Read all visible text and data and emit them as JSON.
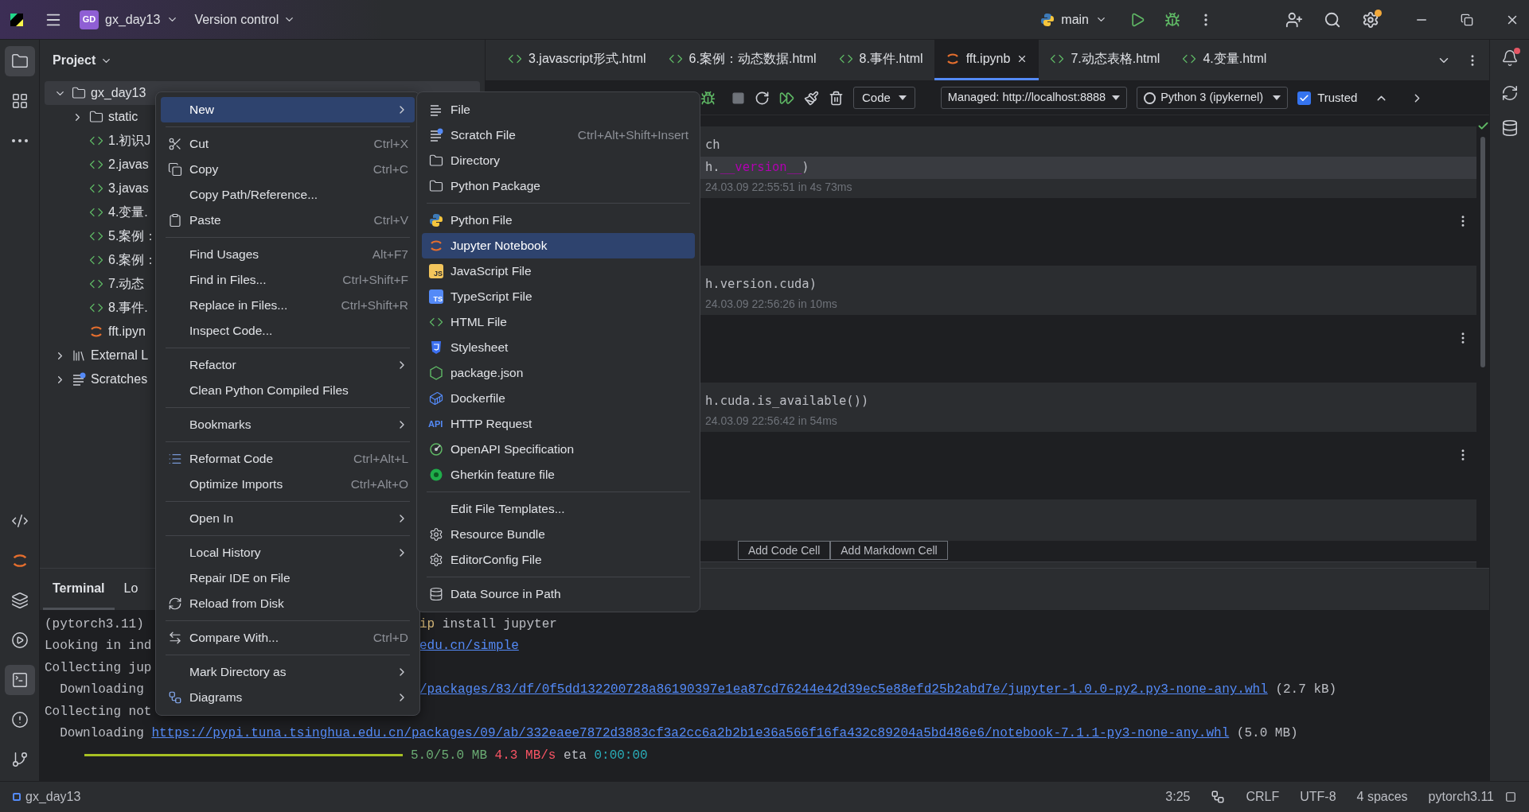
{
  "title_bar": {
    "project_badge": "GD",
    "project": "gx_day13",
    "vcs": "Version control",
    "run_config": "main",
    "settings_badge": true
  },
  "left_toolbar": {
    "top": [
      {
        "selected": true
      },
      {
        "selected": false
      },
      {
        "selected": false
      }
    ],
    "bottom": [
      {
        "selected": false
      },
      {
        "selected": false
      },
      {
        "selected": false
      },
      {
        "selected": false
      },
      {
        "selected": true
      },
      {
        "selected": false
      },
      {
        "selected": false
      }
    ]
  },
  "right_toolbar": [
    {
      "badge": true
    },
    {
      "badge": false
    },
    {
      "badge": false
    }
  ],
  "project_panel": {
    "title": "Project",
    "tree": [
      {
        "label": "gx_day13",
        "kind": "folder",
        "expanded": true,
        "selected": true,
        "children": [
          {
            "label": "static",
            "kind": "folder",
            "expanded": false,
            "selected": false
          },
          {
            "label": "1.初识J",
            "kind": "html",
            "selected": false
          },
          {
            "label": "2.javas",
            "kind": "html",
            "selected": false
          },
          {
            "label": "3.javas",
            "kind": "html",
            "selected": false
          },
          {
            "label": "4.变量.",
            "kind": "html",
            "selected": false
          },
          {
            "label": "5.案例：",
            "kind": "html",
            "selected": false
          },
          {
            "label": "6.案例：",
            "kind": "html",
            "selected": false
          },
          {
            "label": "7.动态",
            "kind": "html",
            "selected": false
          },
          {
            "label": "8.事件.",
            "kind": "html",
            "selected": false
          },
          {
            "label": "fft.ipyn",
            "kind": "notebook",
            "selected": false
          }
        ]
      },
      {
        "label": "External L",
        "kind": "library",
        "expanded": false,
        "selected": false
      },
      {
        "label": "Scratches",
        "kind": "scratches",
        "expanded": false,
        "selected": false
      }
    ]
  },
  "editor_tabs": [
    {
      "label": "3.javascript形式.html",
      "kind": "html",
      "selected": false
    },
    {
      "label": "6.案例：动态数据.html",
      "kind": "html",
      "selected": false
    },
    {
      "label": "8.事件.html",
      "kind": "html",
      "selected": false
    },
    {
      "label": "fft.ipynb",
      "kind": "notebook",
      "selected": true
    },
    {
      "label": "7.动态表格.html",
      "kind": "html",
      "selected": false
    },
    {
      "label": "4.变量.html",
      "kind": "html",
      "selected": false
    }
  ],
  "notebook_toolbar": {
    "cell_type": "Code",
    "server": "Managed: http://localhost:8888",
    "kernel": "Python 3 (ipykernel)",
    "trusted": {
      "label": "Trusted",
      "checked": true
    }
  },
  "cells": [
    {
      "lines": [
        [
          {
            "text": "ch",
            "kind": "plain"
          }
        ],
        [
          {
            "text": "h.",
            "kind": "plain"
          },
          {
            "text": "__version__",
            "kind": "dunder"
          },
          {
            "text": ")",
            "kind": "plain"
          }
        ]
      ],
      "status": "24.03.09 22:55:51 in 4s 73ms"
    },
    {
      "lines": [
        [
          {
            "text": "h.version.cuda)",
            "kind": "plain"
          }
        ]
      ],
      "status": "24.03.09 22:56:26 in 10ms"
    },
    {
      "lines": [
        [
          {
            "text": "h.cuda.is_available())",
            "kind": "plain"
          }
        ]
      ],
      "status": "24.03.09 22:56:42 in 54ms"
    }
  ],
  "add_cell_buttons": [
    "Add Code Cell",
    "Add Markdown Cell"
  ],
  "context_menu": [
    {
      "kind": "item",
      "label": "New",
      "submenu": true,
      "selected": true
    },
    {
      "kind": "separator"
    },
    {
      "kind": "item",
      "label": "Cut",
      "shortcut": "Ctrl+X",
      "submenu": false,
      "selected": false
    },
    {
      "kind": "item",
      "label": "Copy",
      "shortcut": "Ctrl+C",
      "submenu": false,
      "selected": false
    },
    {
      "kind": "item",
      "label": "Copy Path/Reference...",
      "submenu": false,
      "selected": false
    },
    {
      "kind": "item",
      "label": "Paste",
      "shortcut": "Ctrl+V",
      "submenu": false,
      "selected": false
    },
    {
      "kind": "separator"
    },
    {
      "kind": "item",
      "label": "Find Usages",
      "shortcut": "Alt+F7",
      "submenu": false,
      "selected": false
    },
    {
      "kind": "item",
      "label": "Find in Files...",
      "shortcut": "Ctrl+Shift+F",
      "submenu": false,
      "selected": false
    },
    {
      "kind": "item",
      "label": "Replace in Files...",
      "shortcut": "Ctrl+Shift+R",
      "submenu": false,
      "selected": false
    },
    {
      "kind": "item",
      "label": "Inspect Code...",
      "submenu": false,
      "selected": false
    },
    {
      "kind": "separator"
    },
    {
      "kind": "item",
      "label": "Refactor",
      "submenu": true,
      "selected": false
    },
    {
      "kind": "item",
      "label": "Clean Python Compiled Files",
      "submenu": false,
      "selected": false
    },
    {
      "kind": "separator"
    },
    {
      "kind": "item",
      "label": "Bookmarks",
      "submenu": true,
      "selected": false
    },
    {
      "kind": "separator"
    },
    {
      "kind": "item",
      "label": "Reformat Code",
      "shortcut": "Ctrl+Alt+L",
      "submenu": false,
      "selected": false
    },
    {
      "kind": "item",
      "label": "Optimize Imports",
      "shortcut": "Ctrl+Alt+O",
      "submenu": false,
      "selected": false
    },
    {
      "kind": "separator"
    },
    {
      "kind": "item",
      "label": "Open In",
      "submenu": true,
      "selected": false
    },
    {
      "kind": "separator"
    },
    {
      "kind": "item",
      "label": "Local History",
      "submenu": true,
      "selected": false
    },
    {
      "kind": "item",
      "label": "Repair IDE on File",
      "submenu": false,
      "selected": false
    },
    {
      "kind": "item",
      "label": "Reload from Disk",
      "submenu": false,
      "selected": false
    },
    {
      "kind": "separator"
    },
    {
      "kind": "item",
      "label": "Compare With...",
      "shortcut": "Ctrl+D",
      "submenu": false,
      "selected": false
    },
    {
      "kind": "separator"
    },
    {
      "kind": "item",
      "label": "Mark Directory as",
      "submenu": true,
      "selected": false
    },
    {
      "kind": "item",
      "label": "Diagrams",
      "submenu": true,
      "selected": false
    }
  ],
  "new_submenu": [
    {
      "kind": "item",
      "label": "File",
      "selected": false
    },
    {
      "kind": "item",
      "label": "Scratch File",
      "shortcut": "Ctrl+Alt+Shift+Insert",
      "selected": false
    },
    {
      "kind": "item",
      "label": "Directory",
      "selected": false
    },
    {
      "kind": "item",
      "label": "Python Package",
      "selected": false
    },
    {
      "kind": "separator"
    },
    {
      "kind": "item",
      "label": "Python File",
      "selected": false
    },
    {
      "kind": "item",
      "label": "Jupyter Notebook",
      "selected": true
    },
    {
      "kind": "item",
      "label": "JavaScript File",
      "badge": "JS",
      "selected": false
    },
    {
      "kind": "item",
      "label": "TypeScript File",
      "badge": "TS",
      "selected": false
    },
    {
      "kind": "item",
      "label": "HTML File",
      "selected": false
    },
    {
      "kind": "item",
      "label": "Stylesheet",
      "selected": false
    },
    {
      "kind": "item",
      "label": "package.json",
      "selected": false
    },
    {
      "kind": "item",
      "label": "Dockerfile",
      "selected": false
    },
    {
      "kind": "item",
      "label": "HTTP Request",
      "badge": "API",
      "selected": false
    },
    {
      "kind": "item",
      "label": "OpenAPI Specification",
      "selected": false
    },
    {
      "kind": "item",
      "label": "Gherkin feature file",
      "selected": false
    },
    {
      "kind": "separator"
    },
    {
      "kind": "item",
      "label": "Edit File Templates...",
      "selected": false
    },
    {
      "kind": "item",
      "label": "Resource Bundle",
      "selected": false
    },
    {
      "kind": "item",
      "label": "EditorConfig File",
      "selected": false
    },
    {
      "kind": "separator"
    },
    {
      "kind": "item",
      "label": "Data Source in Path",
      "selected": false
    }
  ],
  "terminal": {
    "tabs": [
      {
        "label": "Terminal",
        "selected": true
      },
      {
        "label": "Lo",
        "selected": false
      }
    ],
    "lines": [
      {
        "kind": "text",
        "left": [
          {
            "text": "(pytorch3.11)",
            "kind": "plain"
          }
        ],
        "right": [
          {
            "text": "ip",
            "kind": "command"
          },
          {
            "text": " install jupyter",
            "kind": "plain"
          }
        ]
      },
      {
        "kind": "text",
        "left": [
          {
            "text": "Looking in ind",
            "kind": "plain"
          }
        ],
        "right": [
          {
            "text": "edu.cn/simple",
            "kind": "link"
          }
        ]
      },
      {
        "kind": "text",
        "left": [
          {
            "text": "Collecting jup",
            "kind": "plain"
          }
        ]
      },
      {
        "kind": "text",
        "left": [
          {
            "text": "  Downloading",
            "kind": "plain"
          }
        ],
        "right": [
          {
            "text": "/packages/83/df/0f5dd132200728a86190397e1ea87cd76244e42d39ec5e88efd25b2abd7e/jupyter-1.0.0-py2.py3-none-any.whl",
            "kind": "link"
          },
          {
            "text": " (2.7 kB)",
            "kind": "plain"
          }
        ]
      },
      {
        "kind": "text",
        "left": [
          {
            "text": "Collecting not",
            "kind": "plain"
          }
        ]
      },
      {
        "kind": "text",
        "left": [
          {
            "text": "  Downloading ",
            "kind": "plain"
          },
          {
            "text": "https://pypi.tuna.tsinghua.edu.cn/packages/09/ab/332eaee7872d3883cf3a2cc6a2b2b1e36a566f16fa432c89204a5bd486e6/notebook-7.1.1-py3-none-any.whl",
            "kind": "link"
          },
          {
            "text": " (5.0 MB)",
            "kind": "plain"
          }
        ]
      },
      {
        "kind": "progress",
        "level": 1,
        "left": [
          {
            "text": "5.0/5.0 MB",
            "kind": "green"
          },
          {
            "text": " 4.3 MB/s",
            "kind": "red"
          },
          {
            "text": " eta ",
            "kind": "plain"
          },
          {
            "text": "0:00:00",
            "kind": "cyan"
          }
        ]
      }
    ]
  },
  "status_bar": {
    "project": "gx_day13",
    "position": "3:25",
    "line_separator": "CRLF",
    "encoding": "UTF-8",
    "indent": "4 spaces",
    "interpreter": "pytorch3.11"
  }
}
